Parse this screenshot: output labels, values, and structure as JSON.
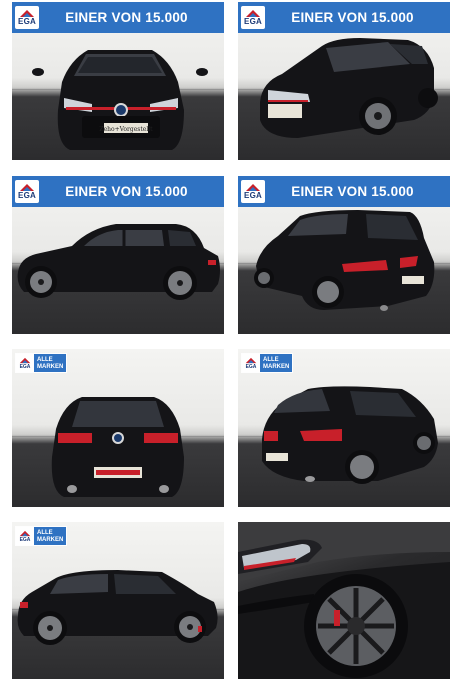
{
  "gallery": {
    "banner_text": "EINER VON 15.000",
    "logo_text": "EGA",
    "badge_line1": "ALLE",
    "badge_line2": "MARKEN",
    "plate_text": "Zeho+Vorgestellt",
    "photos": [
      {
        "view": "front",
        "overlay": "banner"
      },
      {
        "view": "front-left-three-quarter",
        "overlay": "banner"
      },
      {
        "view": "left-side",
        "overlay": "banner"
      },
      {
        "view": "rear-left-three-quarter",
        "overlay": "banner"
      },
      {
        "view": "rear",
        "overlay": "badge"
      },
      {
        "view": "rear-right-three-quarter",
        "overlay": "badge"
      },
      {
        "view": "left-side",
        "overlay": "badge"
      },
      {
        "view": "headlight-wheel-closeup",
        "overlay": "none"
      }
    ]
  },
  "colors": {
    "banner_blue": "#2f72c2",
    "car_body": "#151518",
    "gti_red": "#c8202a"
  }
}
